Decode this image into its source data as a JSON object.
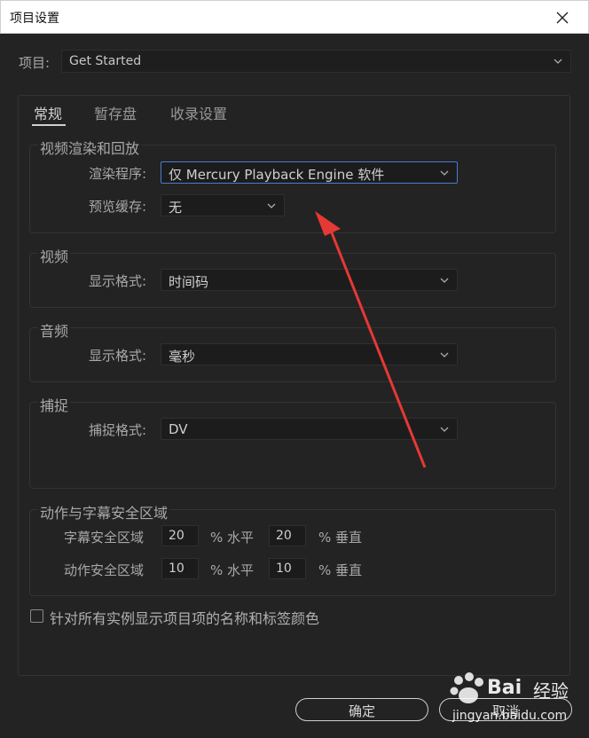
{
  "window": {
    "title": "项目设置"
  },
  "project": {
    "label": "项目:",
    "value": "Get Started"
  },
  "tabs": [
    {
      "label": "常规",
      "active": true
    },
    {
      "label": "暂存盘",
      "active": false
    },
    {
      "label": "收录设置",
      "active": false
    }
  ],
  "video_render": {
    "group_label": "视频渲染和回放",
    "renderer_label": "渲染程序:",
    "renderer_value": "仅 Mercury Playback Engine 软件",
    "preview_cache_label": "预览缓存:",
    "preview_cache_value": "无"
  },
  "video": {
    "group_label": "视频",
    "display_format_label": "显示格式:",
    "display_format_value": "时间码"
  },
  "audio": {
    "group_label": "音频",
    "display_format_label": "显示格式:",
    "display_format_value": "毫秒"
  },
  "capture": {
    "group_label": "捕捉",
    "format_label": "捕捉格式:",
    "format_value": "DV"
  },
  "safe_margins": {
    "group_label": "动作与字幕安全区域",
    "title_safe_label": "字幕安全区域",
    "title_safe_h": "20",
    "title_safe_v": "20",
    "action_safe_label": "动作安全区域",
    "action_safe_h": "10",
    "action_safe_v": "10",
    "unit_h": "% 水平",
    "unit_v": "% 垂直"
  },
  "show_names_checkbox": {
    "label": "针对所有实例显示项目项的名称和标签颜色",
    "checked": false
  },
  "buttons": {
    "ok": "确定",
    "cancel": "取消"
  },
  "watermark": {
    "brand": "Bai",
    "brand2": "经验",
    "url": "jingyan.baidu.com"
  },
  "colors": {
    "background": "#232323",
    "focus": "#4a7bd0",
    "annotation_arrow": "#e53935"
  }
}
